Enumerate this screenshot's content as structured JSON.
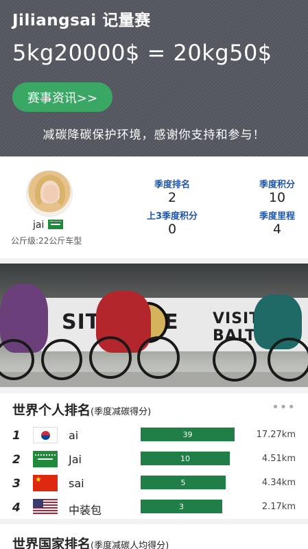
{
  "hero": {
    "title": "Jiliangsai  记量赛",
    "formula": "5kg20000$ = 20kg50$",
    "news_button": "赛事资讯>>",
    "slogan": "减碳降碳保护环境，感谢你支持和参与！"
  },
  "profile": {
    "name": "jai",
    "class_info": "公斤级:22公斤车型",
    "stats": [
      {
        "label": "季度排名",
        "value": "2"
      },
      {
        "label": "季度积分",
        "value": "10"
      },
      {
        "label": "上3季度积分",
        "value": "0"
      },
      {
        "label": "季度里程",
        "value": "4"
      }
    ]
  },
  "banner": {
    "wall_text_left": "SIT  MORE",
    "wall_text_right": "VISIT BALTIMO"
  },
  "world_individual": {
    "title": "世界个人排名",
    "subtitle": "(季度减碳得分)",
    "more": "•••",
    "rows": [
      {
        "rank": "1",
        "flag": "kr-flag-icon",
        "name": "ai",
        "score": 39,
        "score_label": "39",
        "distance": "17.27km"
      },
      {
        "rank": "2",
        "flag": "sa-flag-icon",
        "name": "Jai",
        "score": 10,
        "score_label": "10",
        "distance": "4.51km"
      },
      {
        "rank": "3",
        "flag": "cn-flag-icon",
        "name": "sai",
        "score": 5,
        "score_label": "5",
        "distance": "4.34km"
      },
      {
        "rank": "4",
        "flag": "us-flag-icon",
        "name": "中装包",
        "score": 3,
        "score_label": "3",
        "distance": "2.17km"
      }
    ]
  },
  "world_country": {
    "title": "世界国家排名",
    "subtitle": "(季度减碳人均得分)"
  },
  "colors": {
    "hero_bg": "#5a5d66",
    "button_green": "#3aa864",
    "stat_blue": "#1f56a8",
    "bar_green": "#1f7f47"
  }
}
